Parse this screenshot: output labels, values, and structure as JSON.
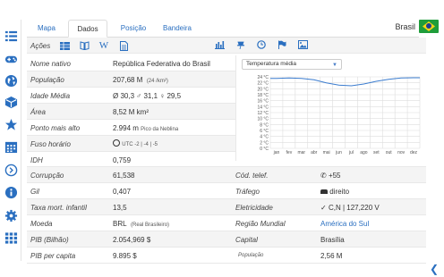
{
  "tabs": [
    {
      "label": "Mapa"
    },
    {
      "label": "Dados"
    },
    {
      "label": "Posição"
    },
    {
      "label": "Bandeira"
    }
  ],
  "country": "Brasil",
  "toolbar": {
    "label": "Ações"
  },
  "rows_left": [
    {
      "label": "Nome nativo",
      "value": "República Federativa do Brasil"
    },
    {
      "label": "População",
      "value": "207,68 M",
      "note": "(24 /km²)"
    },
    {
      "label": "Idade Média",
      "value": "Ø 30,3  ♂ 31,1  ♀ 29,5"
    },
    {
      "label": "Área",
      "value": "8,52 M km²"
    },
    {
      "label": "Ponto mais alto",
      "value": "2.994 m",
      "note": "Pico da Neblina"
    },
    {
      "label": "Fuso horário",
      "value": "UTC -2 | -4 | -5"
    },
    {
      "label": "IDH",
      "value": "0,759"
    }
  ],
  "rows_full": [
    {
      "l1": "Corrupção",
      "v1": "61,538",
      "l2": "Cód. telef.",
      "v2": "+55"
    },
    {
      "l1": "Gil",
      "v1": "0,407",
      "l2": "Tráfego",
      "v2": "direito"
    },
    {
      "l1": "Taxa mort. infantil",
      "v1": "13,5",
      "l2": "Eletricidade",
      "v2": "C,N | 127,220 V"
    },
    {
      "l1": "Moeda",
      "v1": "BRL",
      "v1note": "(Real Brasileiro)",
      "l2": "Região Mundial",
      "v2": "América do Sul"
    },
    {
      "l1": "PIB (Bilhão)",
      "v1": "2.054,969 $",
      "l2": "Capital",
      "v2": "Brasília"
    },
    {
      "l1": "PIB per capita",
      "v1": "9.895 $",
      "l2": "População",
      "v2": "2,56 M"
    }
  ],
  "chart_select": "Temperatura média",
  "chart_data": {
    "type": "line",
    "title": "",
    "xlabel": "",
    "ylabel": "",
    "categories": [
      "jan",
      "fev",
      "mar",
      "abr",
      "mai",
      "jun",
      "jul",
      "ago",
      "set",
      "out",
      "nov",
      "dez"
    ],
    "y_ticks": [
      "24 °C",
      "22 °C",
      "20 °C",
      "18 °C",
      "16 °C",
      "14 °C",
      "12 °C",
      "10 °C",
      "8 °C",
      "6 °C",
      "4 °C",
      "2 °C",
      "0 °C"
    ],
    "series": [
      {
        "values": [
          23.5,
          23.6,
          23.5,
          23.0,
          22.0,
          21.2,
          21.0,
          21.6,
          22.5,
          23.2,
          23.6,
          23.7
        ]
      }
    ],
    "ylim": [
      0,
      25
    ],
    "grid": true,
    "line_color": "#3b7ccf"
  }
}
